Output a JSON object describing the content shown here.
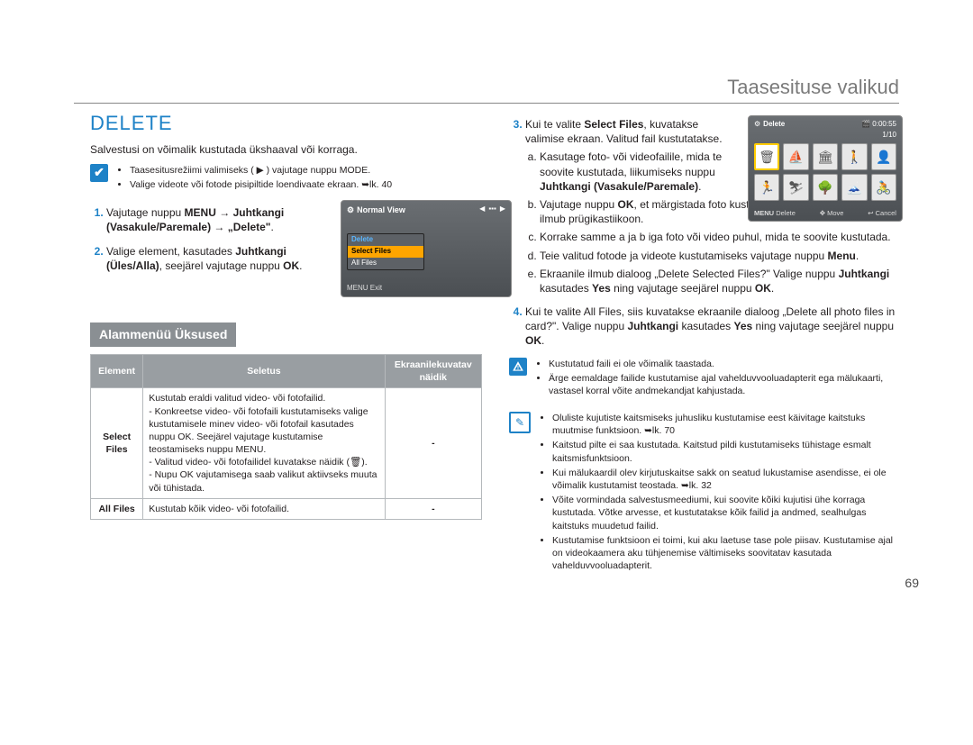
{
  "header": {
    "sectionTitle": "Taasesituse valikud"
  },
  "leftCol": {
    "heading": "DELETE",
    "leadText": "Salvestusi on võimalik kustutada ükshaaval või korraga.",
    "note1_li1": "Taasesitusrežiimi valimiseks ( ▶ ) vajutage nuppu MODE.",
    "note1_li2": "Valige videote või fotode pisipiltide loendivaate ekraan. ➥lk. 40",
    "step1": "Vajutage nuppu MENU → Juhtkangi (Vasakule/Paremale) → „Delete\".",
    "step2": "Valige element, kasutades Juhtkangi (Üles/Alla), seejärel vajutage nuppu OK.",
    "submenuTitle": "Alammenüü Üksused",
    "table": {
      "h1": "Element",
      "h2": "Seletus",
      "h3": "Ekraanilekuvatav näidik",
      "r1c1": "Select Files",
      "r1c2": "Kustutab eraldi valitud video- või fotofailid.\n- Konkreetse video- või fotofaili kustutamiseks valige kustutamisele minev video- või fotofail kasutades nuppu OK. Seejärel vajutage kustutamise teostamiseks nuppu MENU.\n- Valitud video- või fotofailidel kuvatakse näidik (🗑).\n- Nupu OK vajutamisega saab valikut aktiivseks muuta või tühistada.",
      "r1c3": "-",
      "r2c1": "All Files",
      "r2c2": "Kustutab kõik video- või fotofailid.",
      "r2c3": "-"
    }
  },
  "rightCol": {
    "step3_intro": "Kui te valite Select Files, kuvatakse valimise ekraan. Valitud fail kustutatakse.",
    "step3a": "Kasutage foto- või videofailile, mida te soovite kustutada, liikumiseks nuppu Juhtkangi (Vasakule/Paremale).",
    "step3b": "Vajutage nuppu OK, et märgistada foto kustutamiseks. Fotole või videole ilmub prügikastiikoon.",
    "step3c": "Korrake samme a ja b iga foto või video puhul, mida te soovite kustutada.",
    "step3d": "Teie valitud fotode ja videote kustutamiseks vajutage nuppu Menu.",
    "step3e": "Ekraanile ilmub dialoog „Delete Selected Files?\" Valige nuppu Juhtkangi kasutades Yes ning vajutage seejärel nuppu OK.",
    "step4": "Kui te valite All Files, siis kuvatakse ekraanile dialoog „Delete all photo files in card?\". Valige nuppu Juhtkangi kasutades Yes ning vajutage seejärel nuppu OK.",
    "warn_li1": "Kustutatud faili ei ole võimalik taastada.",
    "warn_li2": "Ärge eemaldage failide kustutamise ajal vahelduvvooluadapterit ega mälukaarti, vastasel korral võite andmekandjat kahjustada.",
    "info_li1": "Oluliste kujutiste kaitsmiseks juhusliku kustutamise eest käivitage kaitstuks muutmise funktsioon. ➥lk. 70",
    "info_li2": "Kaitstud pilte ei saa kustutada. Kaitstud pildi kustutamiseks tühistage esmalt kaitsmisfunktsioon.",
    "info_li3": "Kui mälukaardil olev kirjutuskaitse sakk on seatud lukustamise asendisse, ei ole võimalik kustutamist teostada. ➥lk. 32",
    "info_li4": "Võite vormindada salvestusmeediumi, kui soovite kõiki kujutisi ühe korraga kustutada. Võtke arvesse, et kustutatakse kõik failid ja andmed, sealhulgas kaitstuks muudetud failid.",
    "info_li5": "Kustutamise funktsioon ei toimi, kui aku laetuse tase pole piisav. Kustutamise ajal on videokaamera aku tühjenemise vältimiseks soovitatav kasutada vahelduvvooluadapterit."
  },
  "screenshotLeft": {
    "title": "Normal View",
    "menuItem1": "Delete",
    "menuItem2": "Select Files",
    "menuItem3": "All Files",
    "footer": "MENU Exit"
  },
  "screenshotRight": {
    "title": "Delete",
    "timer": "0:00:55",
    "counter": "1/10",
    "btn1": "Delete",
    "btn2": "Move",
    "btn3": "Cancel"
  },
  "pageNumber": "69"
}
